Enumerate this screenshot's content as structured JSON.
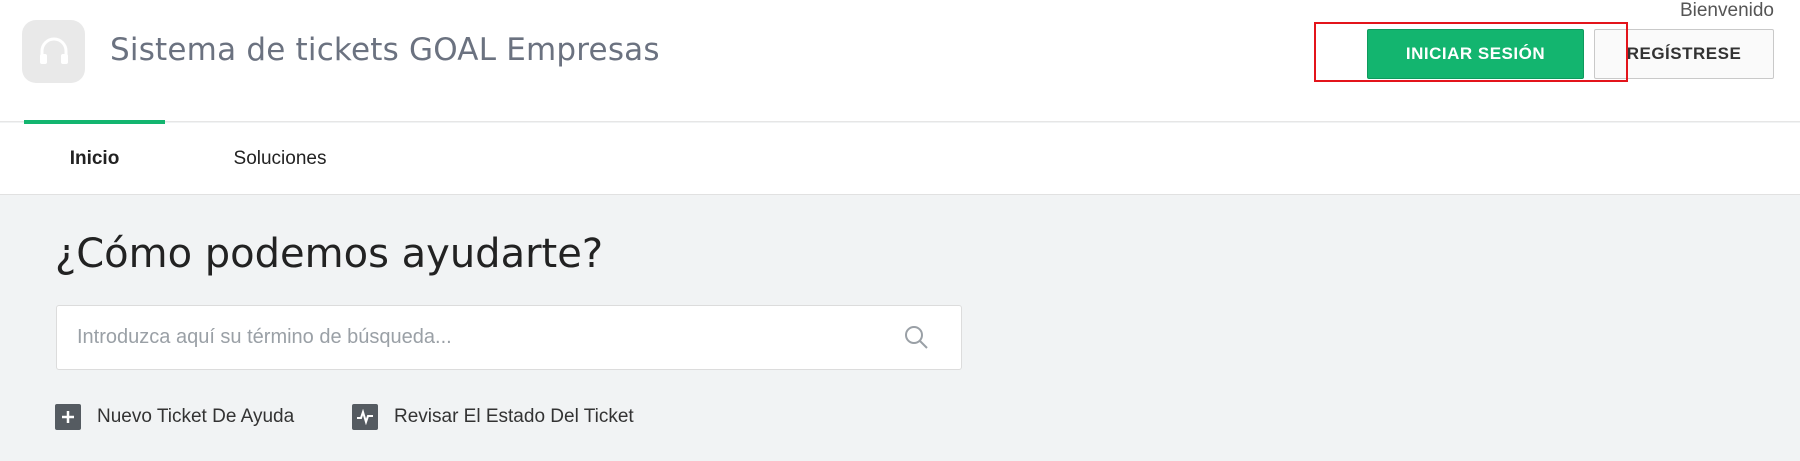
{
  "header": {
    "app_title": "Sistema de tickets GOAL Empresas",
    "welcome": "Bienvenido",
    "login_label": "INICIAR SESIÓN",
    "register_label": "REGÍSTRESE",
    "logo_icon": "headset-icon"
  },
  "nav": {
    "tabs": [
      {
        "label": "Inicio",
        "active": true
      },
      {
        "label": "Soluciones",
        "active": false
      }
    ]
  },
  "main": {
    "title": "¿Cómo podemos ayudarte?",
    "search": {
      "placeholder": "Introduzca aquí su término de búsqueda...",
      "value": "",
      "icon": "search-icon"
    },
    "actions": [
      {
        "label": "Nuevo Ticket De Ayuda",
        "icon": "plus-icon"
      },
      {
        "label": "Revisar El Estado Del Ticket",
        "icon": "activity-icon"
      }
    ]
  },
  "colors": {
    "accent": "#13b56f",
    "highlight": "#e3141b"
  }
}
